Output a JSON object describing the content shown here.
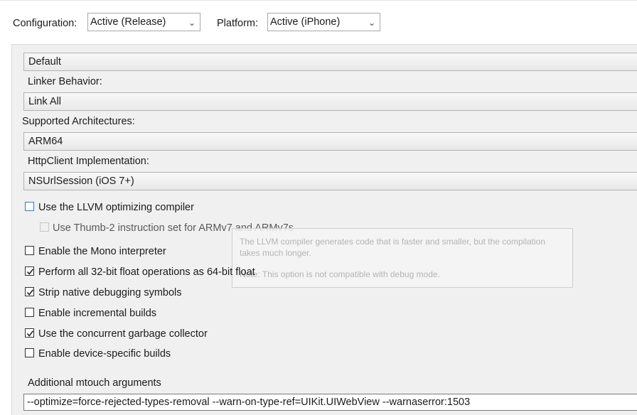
{
  "header": {
    "configuration_label": "Configuration:",
    "configuration_value": "Active (Release)",
    "platform_label": "Platform:",
    "platform_value": "Active (iPhone)"
  },
  "build": {
    "sdk_dropdown_value": "Default",
    "linker_label": "Linker Behavior:",
    "linker_value": "Link All",
    "architectures_label": "Supported Architectures:",
    "architectures_value": "ARM64",
    "httpclient_label": "HttpClient Implementation:",
    "httpclient_value": "NSUrlSession (iOS 7+)"
  },
  "options": [
    {
      "label": "Use the LLVM optimizing compiler",
      "checked": false
    },
    {
      "label": "Use Thumb-2 instruction set for ARMv7 and ARMv7s",
      "checked": false,
      "disabled": true
    },
    {
      "label": "Enable the Mono interpreter",
      "checked": false
    },
    {
      "label": "Perform all 32-bit float operations as 64-bit float",
      "checked": true
    },
    {
      "label": "Strip native debugging symbols",
      "checked": true
    },
    {
      "label": "Enable incremental builds",
      "checked": false
    },
    {
      "label": "Use the concurrent garbage collector",
      "checked": true
    },
    {
      "label": "Enable device-specific builds",
      "checked": false
    }
  ],
  "tooltip": {
    "text": "The LLVM compiler generates code that is faster and smaller, but the compilation takes much longer.",
    "note": "Note: This option is not compatible with debug mode."
  },
  "mtouch": {
    "label": "Additional mtouch arguments",
    "value": "--optimize=force-rejected-types-removal --warn-on-type-ref=UIKit.UIWebView --warnaserror:1503"
  },
  "icons": {
    "dropdown_arrow": "chevron-down-icon",
    "checkmark": "checkmark-icon"
  }
}
